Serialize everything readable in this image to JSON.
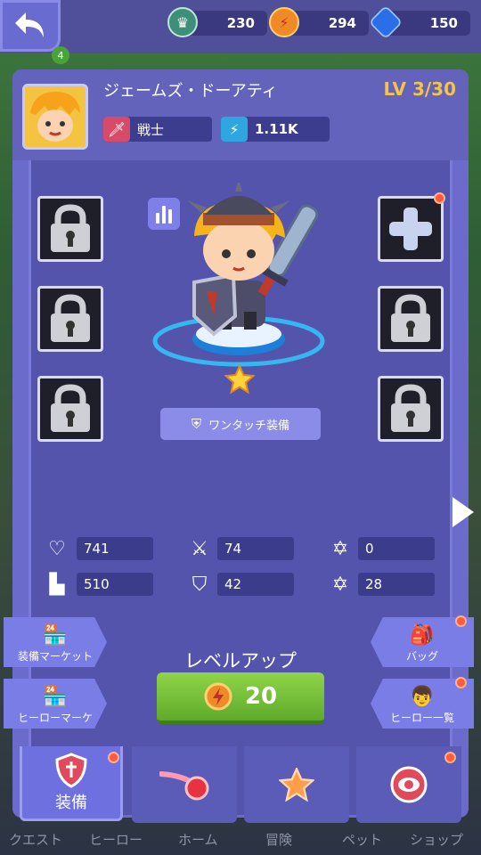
{
  "currencies": [
    {
      "icon": "crown-token-icon",
      "value": "230"
    },
    {
      "icon": "energy-coin-icon",
      "value": "294"
    },
    {
      "icon": "blue-gem-icon",
      "value": "150"
    }
  ],
  "bg_badge": "4",
  "hero": {
    "name": "ジェームズ・ドーアティ",
    "level": "LV 3/30",
    "class_label": "戦士",
    "power": "1.11K"
  },
  "equip": {
    "one_touch": "ワンタッチ装備"
  },
  "stats": {
    "hp": "741",
    "attack": "74",
    "magic": "0",
    "speed": "510",
    "defense": "42",
    "resist": "28"
  },
  "side": {
    "market": "装備マーケット",
    "hero_market": "ヒーローマーケ",
    "bag": "バッグ",
    "hero_list": "ヒーロー一覧"
  },
  "level_up": {
    "label": "レベルアップ",
    "cost": "20"
  },
  "nav": {
    "equip": "装備",
    "bottom": [
      "クエスト",
      "ヒーロー",
      "ホーム",
      "冒険",
      "ペット",
      "ショップ"
    ]
  },
  "colors": {
    "panel": "#6b6bcc",
    "gold": "#f3c44a",
    "green": "#6fbd33",
    "notify": "#ff5a3a"
  }
}
